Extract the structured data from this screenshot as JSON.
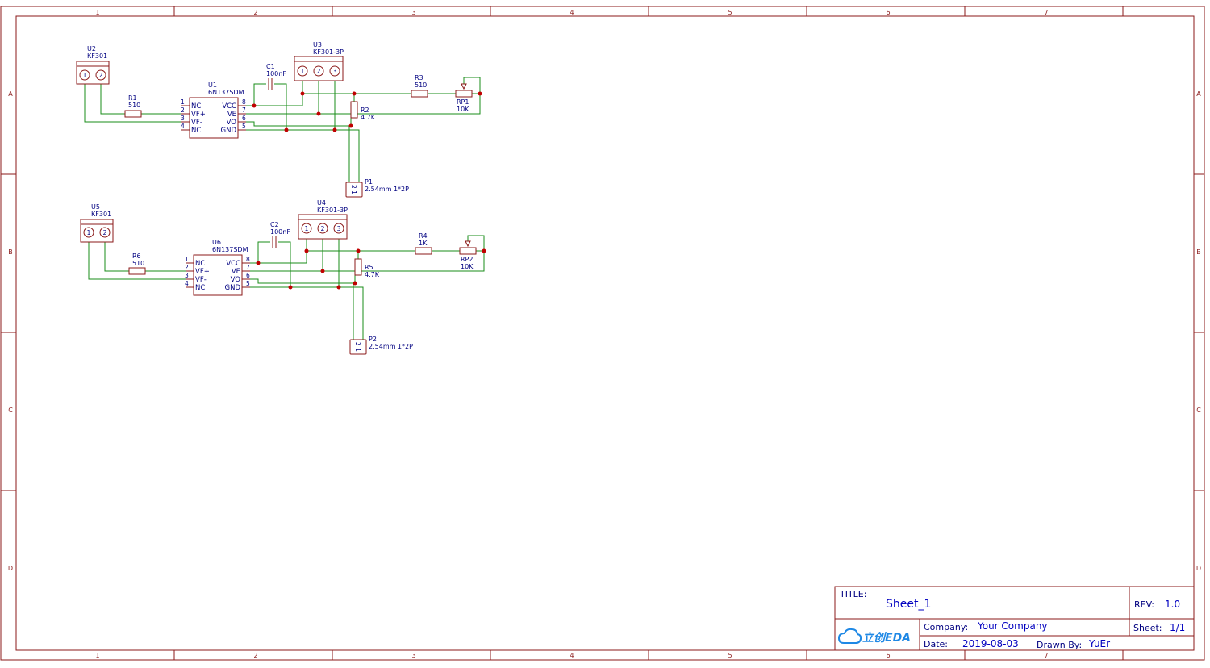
{
  "frame": {
    "col_labels": [
      "1",
      "2",
      "3",
      "4",
      "5",
      "6",
      "7"
    ],
    "row_labels": [
      "A",
      "B",
      "C",
      "D"
    ]
  },
  "circuit1": {
    "u2": {
      "ref": "U2",
      "value": "KF301",
      "pins": [
        "1",
        "2"
      ]
    },
    "u3": {
      "ref": "U3",
      "value": "KF301-3P",
      "pins": [
        "1",
        "2",
        "3"
      ]
    },
    "r1": {
      "ref": "R1",
      "value": "510"
    },
    "c1": {
      "ref": "C1",
      "value": "100nF"
    },
    "r2": {
      "ref": "R2",
      "value": "4.7K"
    },
    "r3": {
      "ref": "R3",
      "value": "510"
    },
    "rp1": {
      "ref": "RP1",
      "value": "10K"
    },
    "p1": {
      "ref": "P1",
      "value": "2.54mm 1*2P",
      "pin_label": "2 1"
    },
    "u1": {
      "ref": "U1",
      "value": "6N137SDM",
      "left_pins": [
        {
          "num": "1",
          "name": "NC"
        },
        {
          "num": "2",
          "name": "VF+"
        },
        {
          "num": "3",
          "name": "VF-"
        },
        {
          "num": "4",
          "name": "NC"
        }
      ],
      "right_pins": [
        {
          "num": "8",
          "name": "VCC"
        },
        {
          "num": "7",
          "name": "VE"
        },
        {
          "num": "6",
          "name": "VO"
        },
        {
          "num": "5",
          "name": "GND"
        }
      ]
    }
  },
  "circuit2": {
    "u5": {
      "ref": "U5",
      "value": "KF301",
      "pins": [
        "1",
        "2"
      ]
    },
    "u4": {
      "ref": "U4",
      "value": "KF301-3P",
      "pins": [
        "1",
        "2",
        "3"
      ]
    },
    "r6": {
      "ref": "R6",
      "value": "510"
    },
    "c2": {
      "ref": "C2",
      "value": "100nF"
    },
    "r5": {
      "ref": "R5",
      "value": "4.7K"
    },
    "r4": {
      "ref": "R4",
      "value": "1K"
    },
    "rp2": {
      "ref": "RP2",
      "value": "10K"
    },
    "p2": {
      "ref": "P2",
      "value": "2.54mm 1*2P",
      "pin_label": "2 1"
    },
    "u6": {
      "ref": "U6",
      "value": "6N137SDM",
      "left_pins": [
        {
          "num": "1",
          "name": "NC"
        },
        {
          "num": "2",
          "name": "VF+"
        },
        {
          "num": "3",
          "name": "VF-"
        },
        {
          "num": "4",
          "name": "NC"
        }
      ],
      "right_pins": [
        {
          "num": "8",
          "name": "VCC"
        },
        {
          "num": "7",
          "name": "VE"
        },
        {
          "num": "6",
          "name": "VO"
        },
        {
          "num": "5",
          "name": "GND"
        }
      ]
    }
  },
  "title_block": {
    "title_label": "TITLE:",
    "title_value": "Sheet_1",
    "rev_label": "REV:",
    "rev_value": "1.0",
    "company_label": "Company:",
    "company_value": "Your Company",
    "sheet_label": "Sheet:",
    "sheet_value": "1/1",
    "date_label": "Date:",
    "date_value": "2019-08-03",
    "drawn_label": "Drawn By:",
    "drawn_value": "YuEr",
    "logo_text": "立创EDA",
    "logo_icon": "cloud-icon"
  },
  "colors": {
    "border": "#8b1a1a",
    "wire": "#1a8c1a",
    "text": "#000080",
    "junction": "#c00000"
  }
}
